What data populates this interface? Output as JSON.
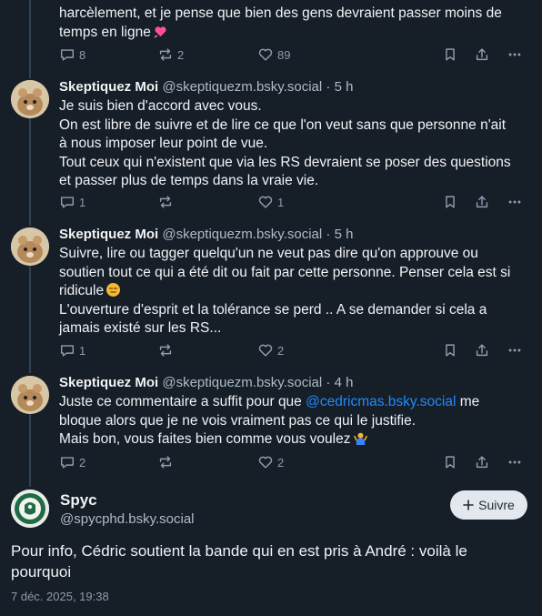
{
  "post0": {
    "text_lines": [
      "harcèlement, et je pense que bien des gens devraient passer moins de",
      "temps en ligne"
    ],
    "emoji": "heart-emoji",
    "replies": "8",
    "reposts": "2",
    "likes": "89"
  },
  "post1": {
    "name": "Skeptiquez Moi",
    "handle": "@skeptiquezm.bsky.social",
    "time": "5 h",
    "text_lines": [
      "Je suis bien d'accord avec vous.",
      "On est libre de suivre et de lire ce que l'on veut sans que personne n'ait",
      "à nous imposer leur point de vue.",
      "Tout ceux qui n'existent que via les RS devraient se poser des questions",
      "et passer plus de temps dans la vraie vie."
    ],
    "replies": "1",
    "reposts": "",
    "likes": "1"
  },
  "post2": {
    "name": "Skeptiquez Moi",
    "handle": "@skeptiquezm.bsky.social",
    "time": "5 h",
    "text_lines": [
      "Suivre, lire ou tagger quelqu'un ne veut pas dire qu'on approuve ou",
      "soutien tout ce qui a été dit ou fait par cette personne. Penser cela est si",
      "ridicule",
      "L'ouverture d'esprit et la tolérance se perd .. A se demander si cela a",
      "jamais existé sur les RS..."
    ],
    "emoji": "expressionless-emoji",
    "replies": "1",
    "reposts": "",
    "likes": "2"
  },
  "post3": {
    "name": "Skeptiquez Moi",
    "handle": "@skeptiquezm.bsky.social",
    "time": "4 h",
    "line1_prefix": "Juste ce commentaire a suffit pour que ",
    "mention": "@cedricmas.bsky.social",
    "line1_suffix": " me",
    "line2": "bloque alors que je ne vois vraiment pas ce qui le justifie.",
    "line3": "Mais bon, vous faites bien comme vous voulez",
    "emoji": "shrug-emoji",
    "replies": "2",
    "reposts": "",
    "likes": "2"
  },
  "main": {
    "name": "Spyc",
    "handle": "@spycphd.bsky.social",
    "follow_label": "Suivre",
    "text": "Pour info, Cédric soutient la bande qui en est pris à André : voilà le pourquoi",
    "date": "7 déc. 2025, 19:38"
  },
  "colors": {
    "background": "#161e27",
    "mention": "#208bfe",
    "thread_line": "#2e4052",
    "muted": "#8d9daf"
  }
}
